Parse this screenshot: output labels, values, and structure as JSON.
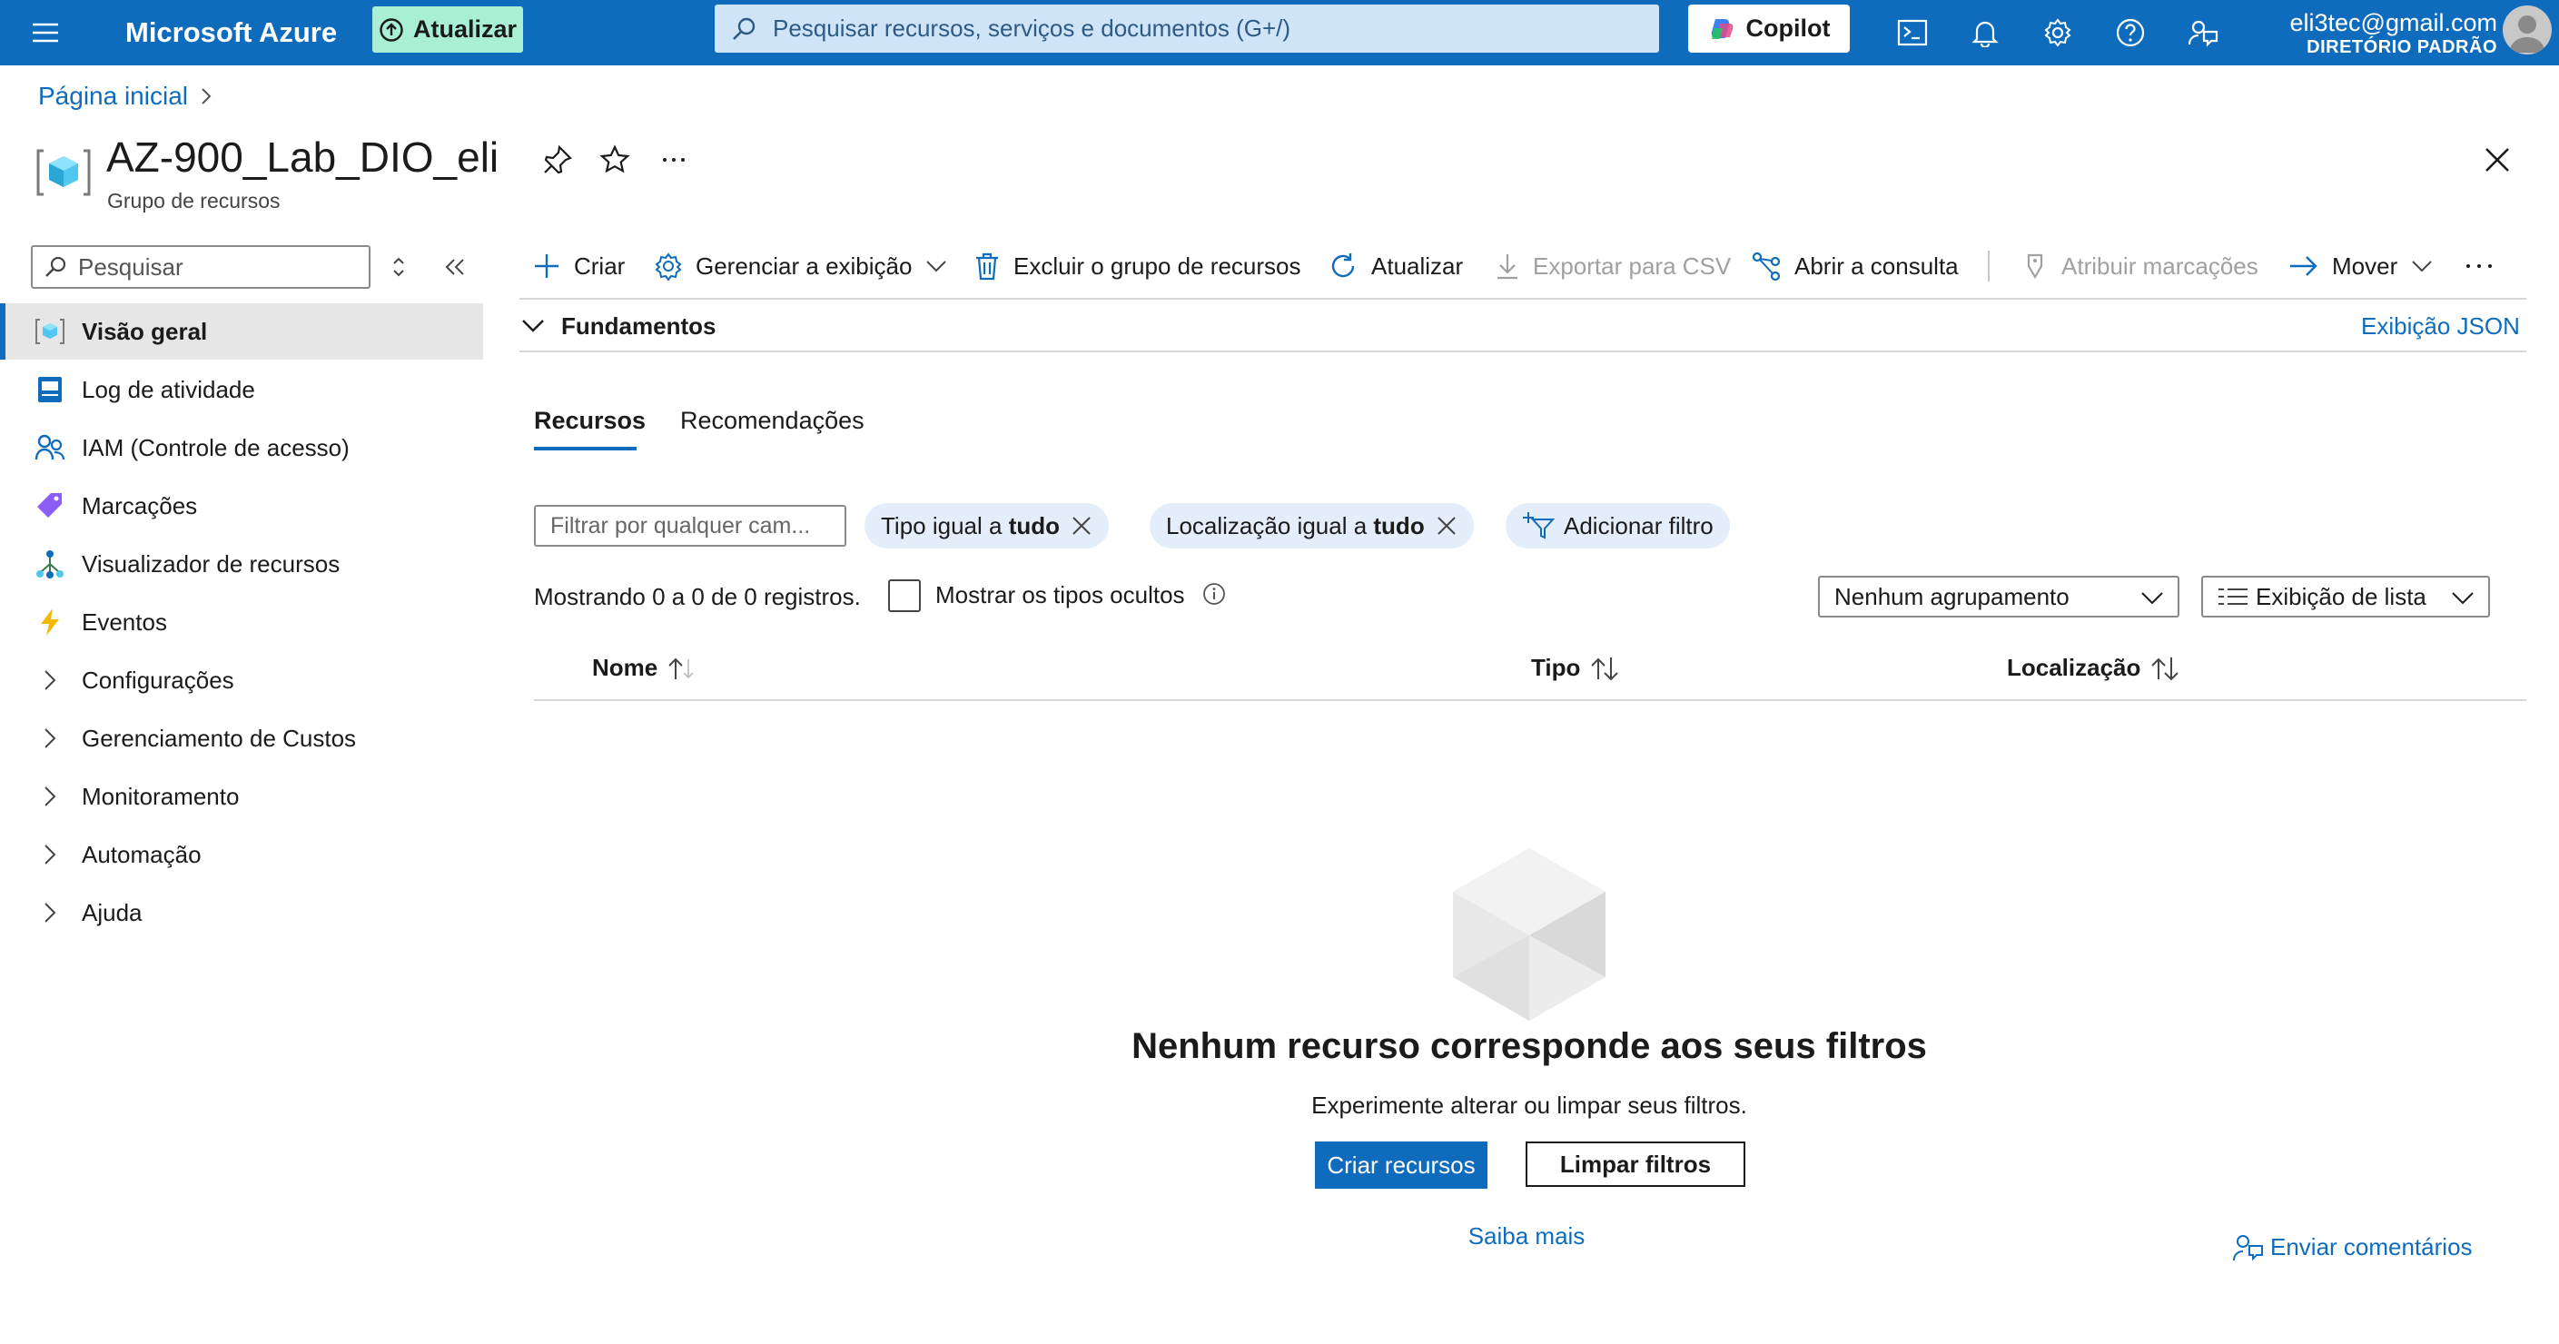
{
  "topbar": {
    "brand": "Microsoft Azure",
    "update_label": "Atualizar",
    "search_placeholder": "Pesquisar recursos, serviços e documentos (G+/)",
    "copilot_label": "Copilot",
    "account_email": "eli3tec@gmail.com",
    "account_directory": "DIRETÓRIO PADRÃO"
  },
  "breadcrumb": {
    "home": "Página inicial"
  },
  "header": {
    "title": "AZ-900_Lab_DIO_eli",
    "subtitle": "Grupo de recursos"
  },
  "sidebar": {
    "search_placeholder": "Pesquisar",
    "items": [
      {
        "label": "Visão geral",
        "icon": "resource-group-icon",
        "selected": true
      },
      {
        "label": "Log de atividade",
        "icon": "activity-log-icon"
      },
      {
        "label": "IAM (Controle de acesso)",
        "icon": "iam-icon"
      },
      {
        "label": "Marcações",
        "icon": "tag-icon"
      },
      {
        "label": "Visualizador de recursos",
        "icon": "resource-visualizer-icon"
      },
      {
        "label": "Eventos",
        "icon": "events-icon"
      },
      {
        "label": "Configurações",
        "icon": "chevron-right-icon"
      },
      {
        "label": "Gerenciamento de Custos",
        "icon": "chevron-right-icon"
      },
      {
        "label": "Monitoramento",
        "icon": "chevron-right-icon"
      },
      {
        "label": "Automação",
        "icon": "chevron-right-icon"
      },
      {
        "label": "Ajuda",
        "icon": "chevron-right-icon"
      }
    ]
  },
  "toolbar": {
    "create": "Criar",
    "manage_view": "Gerenciar a exibição",
    "delete_group": "Excluir o grupo de recursos",
    "refresh": "Atualizar",
    "export_csv": "Exportar para CSV",
    "open_query": "Abrir a consulta",
    "assign_tags": "Atribuir marcações",
    "move": "Mover"
  },
  "essentials": {
    "label": "Fundamentos",
    "json_view": "Exibição JSON"
  },
  "tabs": [
    "Recursos",
    "Recomendações"
  ],
  "filters": {
    "input_placeholder": "Filtrar por qualquer cam...",
    "type_prefix": "Tipo igual a ",
    "type_value": "tudo",
    "location_prefix": "Localização igual a ",
    "location_value": "tudo",
    "add_filter": "Adicionar filtro"
  },
  "records": {
    "showing": "Mostrando 0 a 0 de 0 registros.",
    "show_hidden": "Mostrar os tipos ocultos",
    "grouping": "Nenhum agrupamento",
    "view": "Exibição de lista"
  },
  "table": {
    "columns": [
      "Nome",
      "Tipo",
      "Localização"
    ]
  },
  "empty": {
    "title": "Nenhum recurso corresponde aos seus filtros",
    "subtitle": "Experimente alterar ou limpar seus filtros.",
    "create_button": "Criar recursos",
    "clear_button": "Limpar filtros",
    "learn_more": "Saiba mais"
  },
  "feedback": "Enviar comentários",
  "colors": {
    "accent": "#0f6cbd",
    "update_bg": "#a8efd6",
    "pill_bg": "#e3eefa"
  }
}
